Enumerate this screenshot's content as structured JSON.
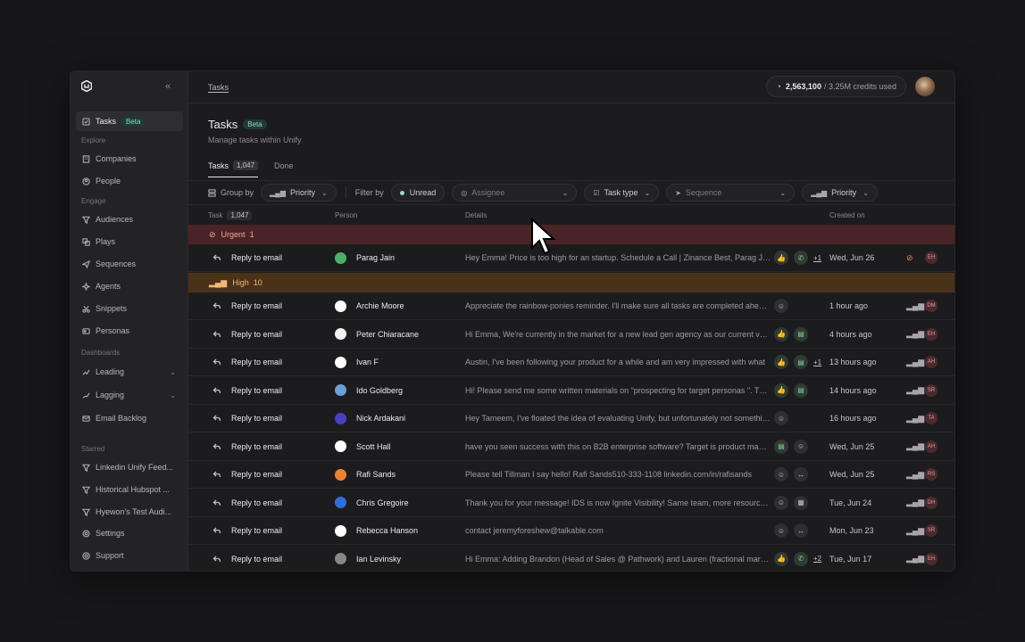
{
  "sidebar": {
    "items": [
      {
        "key": "tasks",
        "label": "Tasks",
        "badge": "Beta"
      },
      {
        "key": "companies",
        "label": "Companies"
      },
      {
        "key": "people",
        "label": "People"
      },
      {
        "key": "audiences",
        "label": "Audiences"
      },
      {
        "key": "plays",
        "label": "Plays"
      },
      {
        "key": "sequences",
        "label": "Sequences"
      },
      {
        "key": "agents",
        "label": "Agents"
      },
      {
        "key": "snippets",
        "label": "Snippets"
      },
      {
        "key": "personas",
        "label": "Personas"
      },
      {
        "key": "leading",
        "label": "Leading"
      },
      {
        "key": "lagging",
        "label": "Lagging"
      },
      {
        "key": "email-backlog",
        "label": "Email Backlog"
      },
      {
        "key": "starred-1",
        "label": "Linkedin Unify Feed..."
      },
      {
        "key": "starred-2",
        "label": "Historical Hubspot ..."
      },
      {
        "key": "starred-3",
        "label": "Hyewon's Test Audi..."
      },
      {
        "key": "settings",
        "label": "Settings"
      },
      {
        "key": "support",
        "label": "Support"
      }
    ],
    "sections": {
      "explore": "Explore",
      "engage": "Engage",
      "dashboards": "Dashboards",
      "starred": "Starred"
    }
  },
  "topbar": {
    "breadcrumb": "Tasks",
    "credits_used": "2,563,100",
    "credits_rest": "/ 3.25M credits used"
  },
  "header": {
    "title": "Tasks",
    "badge": "Beta",
    "subtitle": "Manage tasks within Unify"
  },
  "tabs": [
    {
      "label": "Tasks",
      "count": "1,047"
    },
    {
      "label": "Done"
    }
  ],
  "filters": {
    "group_by_label": "Group by",
    "group_by_value": "Priority",
    "filter_by_label": "Filter by",
    "unread": "Unread",
    "assignee_placeholder": "Assignee",
    "task_type": "Task type",
    "sequence_placeholder": "Sequence",
    "priority": "Priority"
  },
  "table": {
    "columns": {
      "task": "Task",
      "task_count": "1,047",
      "person": "Person",
      "details": "Details",
      "created": "Created on"
    },
    "groups": {
      "urgent": {
        "label": "Urgent",
        "count": "1"
      },
      "high": {
        "label": "High",
        "count": "10"
      }
    },
    "rows": [
      {
        "task": "Reply to email",
        "person": "Parag Jain",
        "details": "Hey Emma! Price is too high for an startup. Schedule a Call | Zinance Best, Parag Jain",
        "created": "Wed, Jun 26",
        "assignee": "EH",
        "extra": "+1"
      },
      {
        "task": "Reply to email",
        "person": "Archie Moore",
        "details": "Appreciate the rainbow-ponies reminder. I'll make sure all tasks are completed ahead of time.",
        "created": "1 hour ago",
        "assignee": "DM"
      },
      {
        "task": "Reply to email",
        "person": "Peter Chiaracane",
        "details": "Hi Emma, We're currently in the market for a new lead gen agency as our current vendor",
        "created": "4 hours ago",
        "assignee": "EH"
      },
      {
        "task": "Reply to email",
        "person": "Ivan F",
        "details": "Austin, I've been following your product for a while and am very impressed with what",
        "created": "13 hours ago",
        "assignee": "AH",
        "extra": "+1"
      },
      {
        "task": "Reply to email",
        "person": "Ido Goldberg",
        "details": "Hi! Please send me some written materials on \"prospecting for target personas \". Thanks",
        "created": "14 hours ago",
        "assignee": "SR"
      },
      {
        "task": "Reply to email",
        "person": "Nick Ardakani",
        "details": "Hey Tameem, I've floated the idea of evaluating Unify, but unfortunately not something our team",
        "created": "16 hours ago",
        "assignee": "TA"
      },
      {
        "task": "Reply to email",
        "person": "Scott Hall",
        "details": "have you seen success with this on B2B enterprise software? Target is product managers",
        "created": "Wed, Jun 25",
        "assignee": "AH"
      },
      {
        "task": "Reply to email",
        "person": "Rafi Sands",
        "details": "Please tell Tillman I say hello! Rafi Sands510-333-1108 linkedin.com/in/rafisands",
        "created": "Wed, Jun 25",
        "assignee": "RS"
      },
      {
        "task": "Reply to email",
        "person": "Chris Gregoire",
        "details": "Thank you for your message! IDS is now Ignite Visibility! Same team, more resources, more",
        "created": "Tue, Jun 24",
        "assignee": "DH"
      },
      {
        "task": "Reply to email",
        "person": "Rebecca Hanson",
        "details": "contact jeremyforeshew@talkable.com",
        "created": "Mon, Jun 23",
        "assignee": "SR"
      },
      {
        "task": "Reply to email",
        "person": "Ian Levinsky",
        "details": "Hi Emma: Adding Brandon (Head of Sales @ Pathwork) and Lauren (fractional marketing)",
        "created": "Tue, Jun 17",
        "assignee": "EH",
        "extra": "+2"
      }
    ]
  }
}
